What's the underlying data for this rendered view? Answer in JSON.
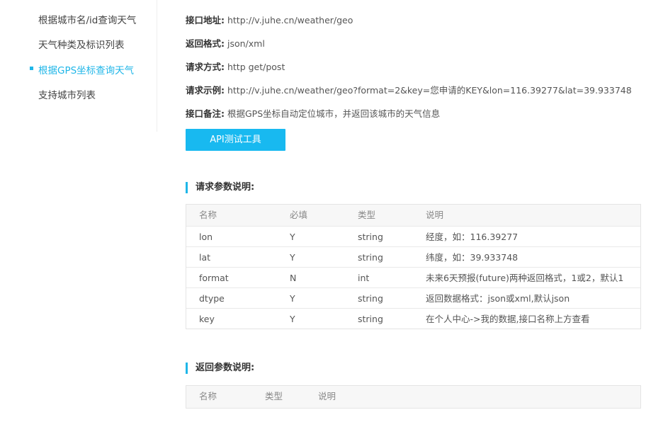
{
  "sidebar": {
    "items": [
      {
        "label": "根据城市名/id查询天气",
        "active": false
      },
      {
        "label": "天气种类及标识列表",
        "active": false
      },
      {
        "label": "根据GPS坐标查询天气",
        "active": true
      },
      {
        "label": "支持城市列表",
        "active": false
      }
    ]
  },
  "api_info": {
    "url_label": "接口地址:",
    "url_value": "http://v.juhe.cn/weather/geo",
    "format_label": "返回格式:",
    "format_value": "json/xml",
    "method_label": "请求方式:",
    "method_value": "http get/post",
    "example_label": "请求示例:",
    "example_value": "http://v.juhe.cn/weather/geo?format=2&key=您申请的KEY&lon=116.39277&lat=39.933748",
    "note_label": "接口备注:",
    "note_value": "根据GPS坐标自动定位城市，并返回该城市的天气信息"
  },
  "api_test_button": "API测试工具",
  "request_params": {
    "title": "请求参数说明:",
    "headers": [
      "名称",
      "必填",
      "类型",
      "说明"
    ],
    "rows": [
      [
        "lon",
        "Y",
        "string",
        "经度，如：116.39277"
      ],
      [
        "lat",
        "Y",
        "string",
        "纬度，如：39.933748"
      ],
      [
        "format",
        "N",
        "int",
        "未来6天预报(future)两种返回格式，1或2，默认1"
      ],
      [
        "dtype",
        "Y",
        "string",
        "返回数据格式：json或xml,默认json"
      ],
      [
        "key",
        "Y",
        "string",
        "在个人中心->我的数据,接口名称上方查看"
      ]
    ]
  },
  "response_params": {
    "title": "返回参数说明:",
    "headers": [
      "名称",
      "类型",
      "说明"
    ]
  },
  "colors": {
    "accent": "#1fb6e8",
    "button": "#18b9f0"
  }
}
